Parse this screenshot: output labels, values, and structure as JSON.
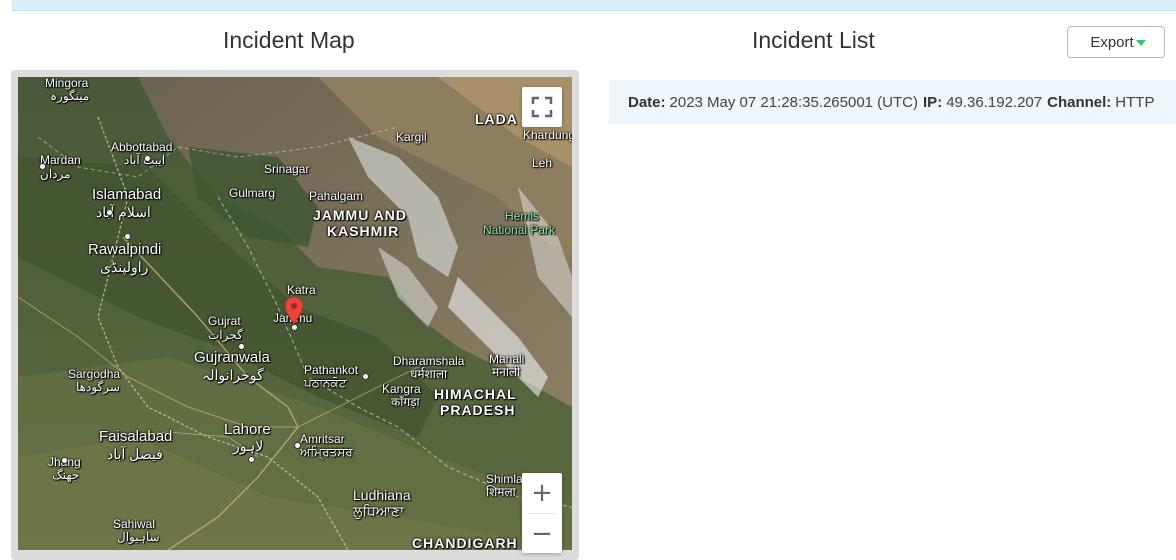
{
  "header": {
    "map_title": "Incident Map",
    "list_title": "Incident List",
    "export_label": "Export"
  },
  "map": {
    "labels": {
      "mingora": "Mingora",
      "mingora_ur": "مینگورہ",
      "abbottabad": "Abbottabad",
      "abbottabad_ur": "ایبٹ آباد",
      "mardan": "Mardan",
      "mardan_ur": "مردان",
      "islamabad": "Islamabad",
      "islamabad_ur": "اسلام آباد",
      "rawalpindi": "Rawalpindi",
      "rawalpindi_ur": "راولپنڈی",
      "srinagar": "Srinagar",
      "gulmarg": "Gulmarg",
      "pahalgam": "Pahalgam",
      "kargil": "Kargil",
      "ladakh": "LADA",
      "khardung": "Khardung",
      "leh": "Leh",
      "jk_line1": "JAMMU AND",
      "jk_line2": "KASHMIR",
      "hemis_line1": "Hemis",
      "hemis_line2": "National Park",
      "katra": "Katra",
      "jammu": "Jammu",
      "gujrat": "Gujrat",
      "gujrat_ur": "گجرات",
      "gujranwala": "Gujranwala",
      "gujranwala_ur": "گوجرانوالہ",
      "sargodha": "Sargodha",
      "sargodha_ur": "سرگودھا",
      "pathankot": "Pathankot",
      "pathankot_pa": "ਪਠਾਨਕੋਟ",
      "dharamshala": "Dharamshala",
      "dharamshala_hi": "धर्मशाला",
      "manali": "Manali",
      "manali_hi": "मनाली",
      "kangra": "Kangra",
      "kangra_hi": "काँगड़ा",
      "hp_line1": "HIMACHAL",
      "hp_line2": "PRADESH",
      "faisalabad": "Faisalabad",
      "faisalabad_ur": "فیصل آباد",
      "lahore": "Lahore",
      "lahore_ur": "لاہور",
      "amritsar": "Amritsar",
      "amritsar_pa": "ਅੰਮ੍ਰਿਤਸਰ",
      "jhang": "Jhang",
      "jhang_ur": "جھنگ",
      "shimla": "Shimla",
      "shimla_hi": "शिमला",
      "ludhiana": "Ludhiana",
      "ludhiana_pa": "ਲੁਧਿਆਣਾ",
      "sahiwal": "Sahiwal",
      "sahiwal_ur": "ساہیوال",
      "chandigarh": "CHANDIGARH"
    },
    "controls": {
      "zoom_in": "+",
      "zoom_out": "−"
    },
    "marker_icon": "map-pin-icon",
    "fullscreen_icon": "fullscreen-icon"
  },
  "incidents": [
    {
      "date_label": "Date:",
      "date_value": "2023 May 07 21:28:35.265001 (UTC)",
      "ip_label": "IP:",
      "ip_value": "49.36.192.207",
      "channel_label": "Channel:",
      "channel_value": "HTTP"
    }
  ],
  "colors": {
    "top_strip": "#d9eef6",
    "card_bg": "#eef5fb",
    "export_caret": "#2ecc71",
    "marker": "#e8453c"
  }
}
